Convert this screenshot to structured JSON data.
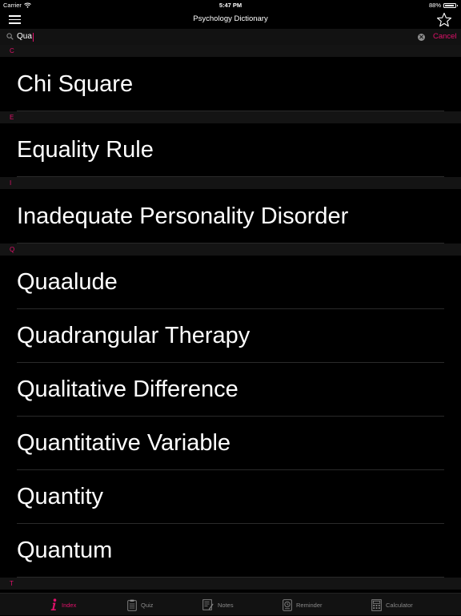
{
  "status_bar": {
    "carrier": "Carrier",
    "time": "5:47 PM",
    "battery": "88%",
    "battery_level": 0.88
  },
  "nav": {
    "title": "Psychology Dictionary",
    "menu_icon": "hamburger-menu-icon",
    "favorite_icon": "star-icon"
  },
  "search": {
    "query": "Qua",
    "cancel_label": "Cancel",
    "search_icon": "magnifier-icon",
    "clear_icon": "clear-icon"
  },
  "sections": [
    {
      "letter": "C",
      "items": [
        "Chi Square"
      ]
    },
    {
      "letter": "E",
      "items": [
        "Equality Rule"
      ]
    },
    {
      "letter": "I",
      "items": [
        "Inadequate Personality Disorder"
      ]
    },
    {
      "letter": "Q",
      "items": [
        "Quaalude",
        "Quadrangular Therapy",
        "Qualitative Difference",
        "Quantitative Variable",
        "Quantity",
        "Quantum"
      ]
    },
    {
      "letter": "T",
      "items": []
    }
  ],
  "tabs": [
    {
      "label": "Index",
      "icon": "info-icon",
      "active": true
    },
    {
      "label": "Quiz",
      "icon": "clipboard-icon",
      "active": false
    },
    {
      "label": "Notes",
      "icon": "notes-icon",
      "active": false
    },
    {
      "label": "Reminder",
      "icon": "clock-icon",
      "active": false
    },
    {
      "label": "Calculator",
      "icon": "calculator-icon",
      "active": false
    }
  ],
  "colors": {
    "accent": "#e0116a",
    "background": "#000000",
    "section_header_bg": "#141414",
    "inactive_tab": "#8a8a8a"
  }
}
